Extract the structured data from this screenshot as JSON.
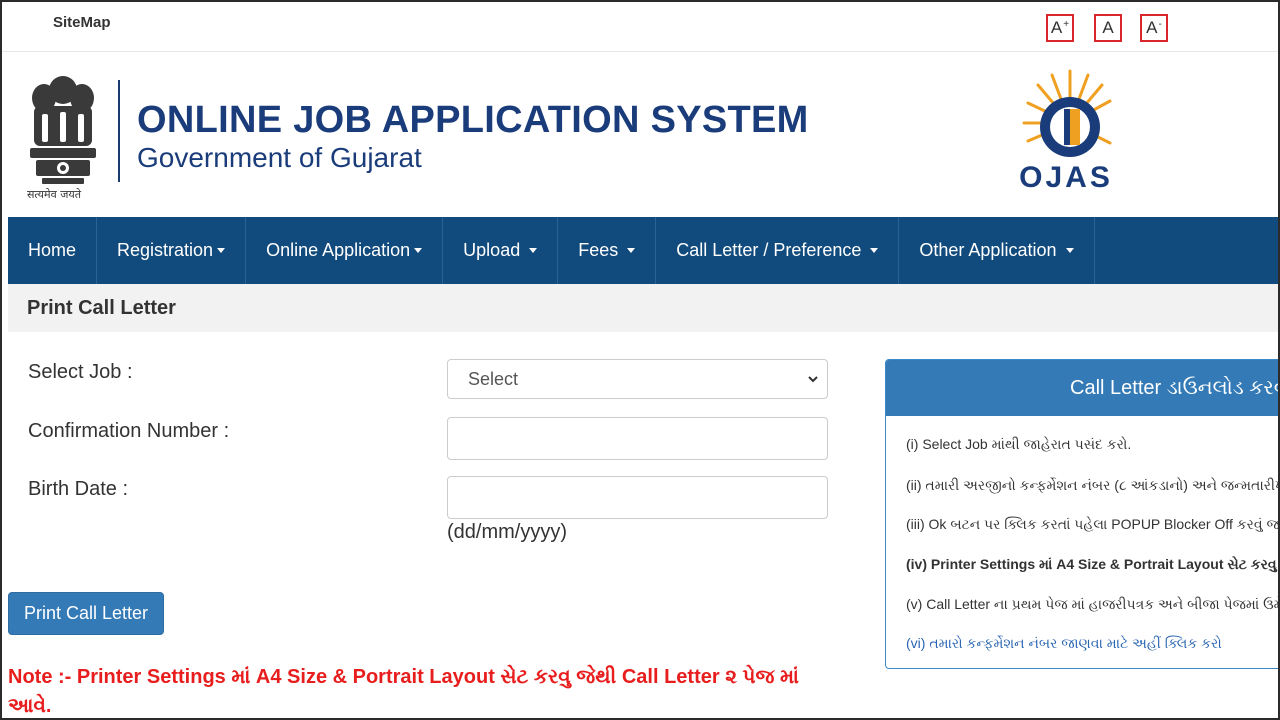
{
  "topbar": {
    "sitemap": "SiteMap",
    "font_increase": "A",
    "font_increase_sup": "+",
    "font_normal": "A",
    "font_decrease": "A",
    "font_decrease_sup": "-"
  },
  "header": {
    "title": "ONLINE JOB APPLICATION SYSTEM",
    "subtitle": "Government of Gujarat",
    "emblem_motto": "सत्यमेव जयते",
    "logo_text": "OJAS"
  },
  "nav": {
    "items": [
      {
        "label": "Home"
      },
      {
        "label": "Registration"
      },
      {
        "label": "Online Application"
      },
      {
        "label": "Upload"
      },
      {
        "label": "Fees"
      },
      {
        "label": "Call Letter / Preference"
      },
      {
        "label": "Other Application"
      }
    ]
  },
  "page": {
    "title": "Print Call Letter"
  },
  "form": {
    "select_job_label": "Select Job :",
    "select_job_value": "Select",
    "confirmation_label": "Confirmation Number :",
    "confirmation_value": "",
    "birth_date_label": "Birth Date :",
    "birth_date_value": "",
    "birth_date_hint": "(dd/mm/yyyy)",
    "submit_label": "Print Call Letter"
  },
  "note": "Note :- Printer Settings માં A4 Size & Portrait Layout સેટ કરવુ જેથી Call Letter ૨ પેજ માં આવે.",
  "panel": {
    "title": "Call Letter ડાઉનલોડ કરવ",
    "items": [
      "(i) Select Job માંથી જાહેરાત પસંદ કરો.",
      "(ii) તમારી અરજીનો કન્ફર્મેશન નંબર (૮ આંકડાનો) અને જન્મતારીખ",
      "(iii) Ok બટન પર ક્લિક કરતાં પહેલા POPUP Blocker Off કરવું જરૂ",
      "(iv) Printer Settings માં A4 Size & Portrait Layout સેટ કરવુ",
      "(v) Call Letter ના પ્રથમ પેજ માં હાજરીપત્રક અને બીજા પેજમાં ઉમેદ",
      "(vi) તમારો કન્ફર્મેશન નંબર જાણવા માટે અહીં ક્લિક કરો"
    ]
  },
  "colors": {
    "nav_bg": "#114a7c",
    "title_blue": "#1a3c7a",
    "button_blue": "#337ab7",
    "note_red": "#e81e1e",
    "font_btn_border": "#d9262b"
  }
}
